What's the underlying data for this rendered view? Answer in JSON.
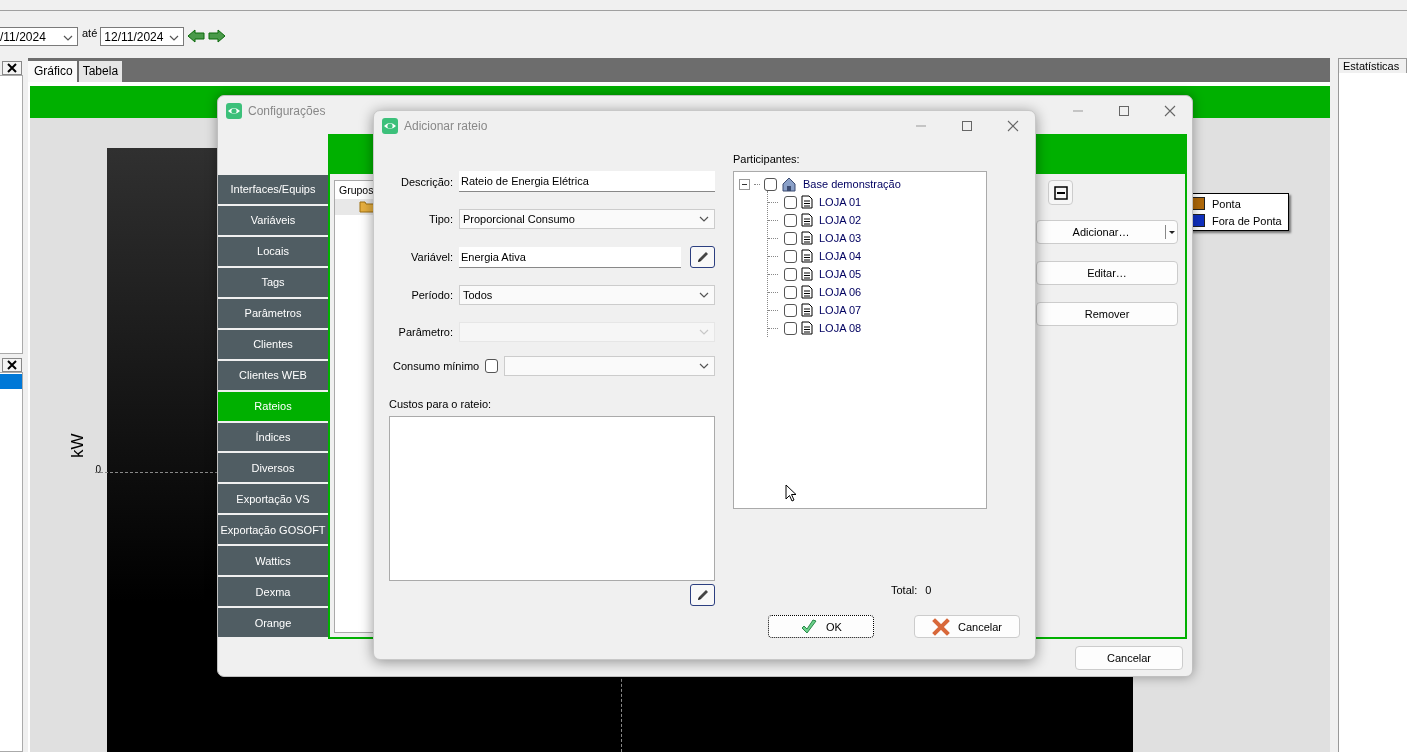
{
  "toolbar": {
    "date_from": "/11/2024",
    "until_label": "até",
    "date_to": "12/11/2024"
  },
  "view_tabs": [
    {
      "label": "Gráfico",
      "selected": true
    },
    {
      "label": "Tabela",
      "selected": false
    }
  ],
  "chart": {
    "ylabel": "kW",
    "ytick": "0",
    "legend": [
      {
        "label": "Ponta",
        "color": "#b0690a"
      },
      {
        "label": "Fora de Ponta",
        "color": "#1030c0"
      }
    ]
  },
  "side_tab": {
    "label": "Estatísticas"
  },
  "config_window": {
    "title": "Configurações",
    "nav": [
      {
        "label": "Interfaces/Equips",
        "selected": false
      },
      {
        "label": "Variáveis",
        "selected": false
      },
      {
        "label": "Locais",
        "selected": false
      },
      {
        "label": "Tags",
        "selected": false
      },
      {
        "label": "Parâmetros",
        "selected": false
      },
      {
        "label": "Clientes",
        "selected": false
      },
      {
        "label": "Clientes WEB",
        "selected": false
      },
      {
        "label": "Rateios",
        "selected": true
      },
      {
        "label": "Índices",
        "selected": false
      },
      {
        "label": "Diversos",
        "selected": false
      },
      {
        "label": "Exportação VS",
        "selected": false
      },
      {
        "label": "Exportação GOSOFT",
        "selected": false
      },
      {
        "label": "Wattics",
        "selected": false
      },
      {
        "label": "Dexma",
        "selected": false
      },
      {
        "label": "Orange",
        "selected": false
      }
    ],
    "groups_header": "Grupos",
    "add_button": "Adicionar…",
    "edit_button": "Editar…",
    "remove_button": "Remover",
    "cancel_button": "Cancelar"
  },
  "dialog": {
    "title": "Adicionar rateio",
    "fields": [
      {
        "label": "Descrição:",
        "kind": "text",
        "value": "Rateio de Energia Elétrica",
        "disabled": false
      },
      {
        "label": "Tipo:",
        "kind": "select",
        "value": "Proporcional Consumo",
        "disabled": false
      },
      {
        "label": "Variável:",
        "kind": "picker",
        "value": "Energia Ativa",
        "disabled": false
      },
      {
        "label": "Período:",
        "kind": "select",
        "value": "Todos",
        "disabled": false
      },
      {
        "label": "Parâmetro:",
        "kind": "select",
        "disabled": true
      }
    ],
    "min_consumption": {
      "label": "Consumo mínimo",
      "checked": false
    },
    "costs_label": "Custos para o rateio:",
    "participants_label": "Participantes:",
    "tree": {
      "label": "Base demonstração",
      "checked": false,
      "expanded": true,
      "children": [
        {
          "label": "LOJA 01",
          "checked": false
        },
        {
          "label": "LOJA 02",
          "checked": false
        },
        {
          "label": "LOJA 03",
          "checked": false
        },
        {
          "label": "LOJA 04",
          "checked": false
        },
        {
          "label": "LOJA 05",
          "checked": false
        },
        {
          "label": "LOJA 06",
          "checked": false
        },
        {
          "label": "LOJA 07",
          "checked": false
        },
        {
          "label": "LOJA 08",
          "checked": false
        }
      ]
    },
    "total_label": "Total:",
    "total_value": "0",
    "ok_button": "OK",
    "cancel_button": "Cancelar"
  }
}
